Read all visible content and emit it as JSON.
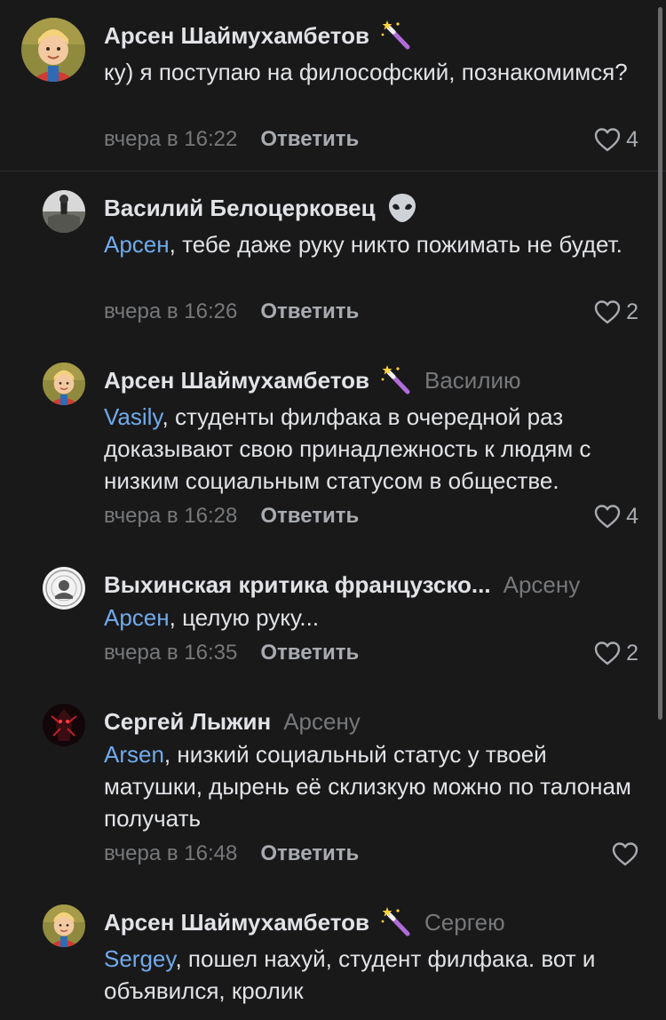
{
  "comments": [
    {
      "author": "Арсен Шаймухамбетов",
      "badge_icon": "magic-wand-emoji",
      "reply_to": "",
      "mention": "",
      "text": "ку) я поступаю на философский, познакомимся?",
      "time": "вчера в 16:22",
      "reply_label": "Ответить",
      "likes": "4"
    },
    {
      "author": "Василий Белоцерковец",
      "badge_icon": "alien-emoji",
      "reply_to": "",
      "mention": "Арсен",
      "text": ", тебе даже руку никто пожимать не будет.",
      "time": "вчера в 16:26",
      "reply_label": "Ответить",
      "likes": "2"
    },
    {
      "author": "Арсен Шаймухамбетов",
      "badge_icon": "magic-wand-emoji",
      "reply_to": "Василию",
      "mention": "Vasily",
      "text": ", студенты филфака в очередной раз доказывают свою принадлежность к людям с низким социальным статусом в обществе.",
      "time": "вчера в 16:28",
      "reply_label": "Ответить",
      "likes": "4"
    },
    {
      "author": "Выхинская критика французско...",
      "badge_icon": "",
      "reply_to": "Арсену",
      "mention": "Арсен",
      "text": ", целую руку...",
      "time": "вчера в 16:35",
      "reply_label": "Ответить",
      "likes": "2"
    },
    {
      "author": "Сергей Лыжин",
      "badge_icon": "",
      "reply_to": "Арсену",
      "mention": "Arsen",
      "text": ", низкий социальный статус у твоей матушки, дырень её склизкую можно по талонам получать",
      "time": "вчера в 16:48",
      "reply_label": "Ответить",
      "likes": ""
    },
    {
      "author": "Арсен Шаймухамбетов",
      "badge_icon": "magic-wand-emoji",
      "reply_to": "Сергею",
      "mention": "Sergey",
      "text": ", пошел нахуй, студент филфака. вот и объявился, кролик",
      "time": "",
      "reply_label": "",
      "likes": ""
    }
  ],
  "colors": {
    "background": "#19191a",
    "text": "#e1e3e6",
    "secondary": "#76787a",
    "mention": "#71aaeb",
    "action": "#a8abaf"
  }
}
